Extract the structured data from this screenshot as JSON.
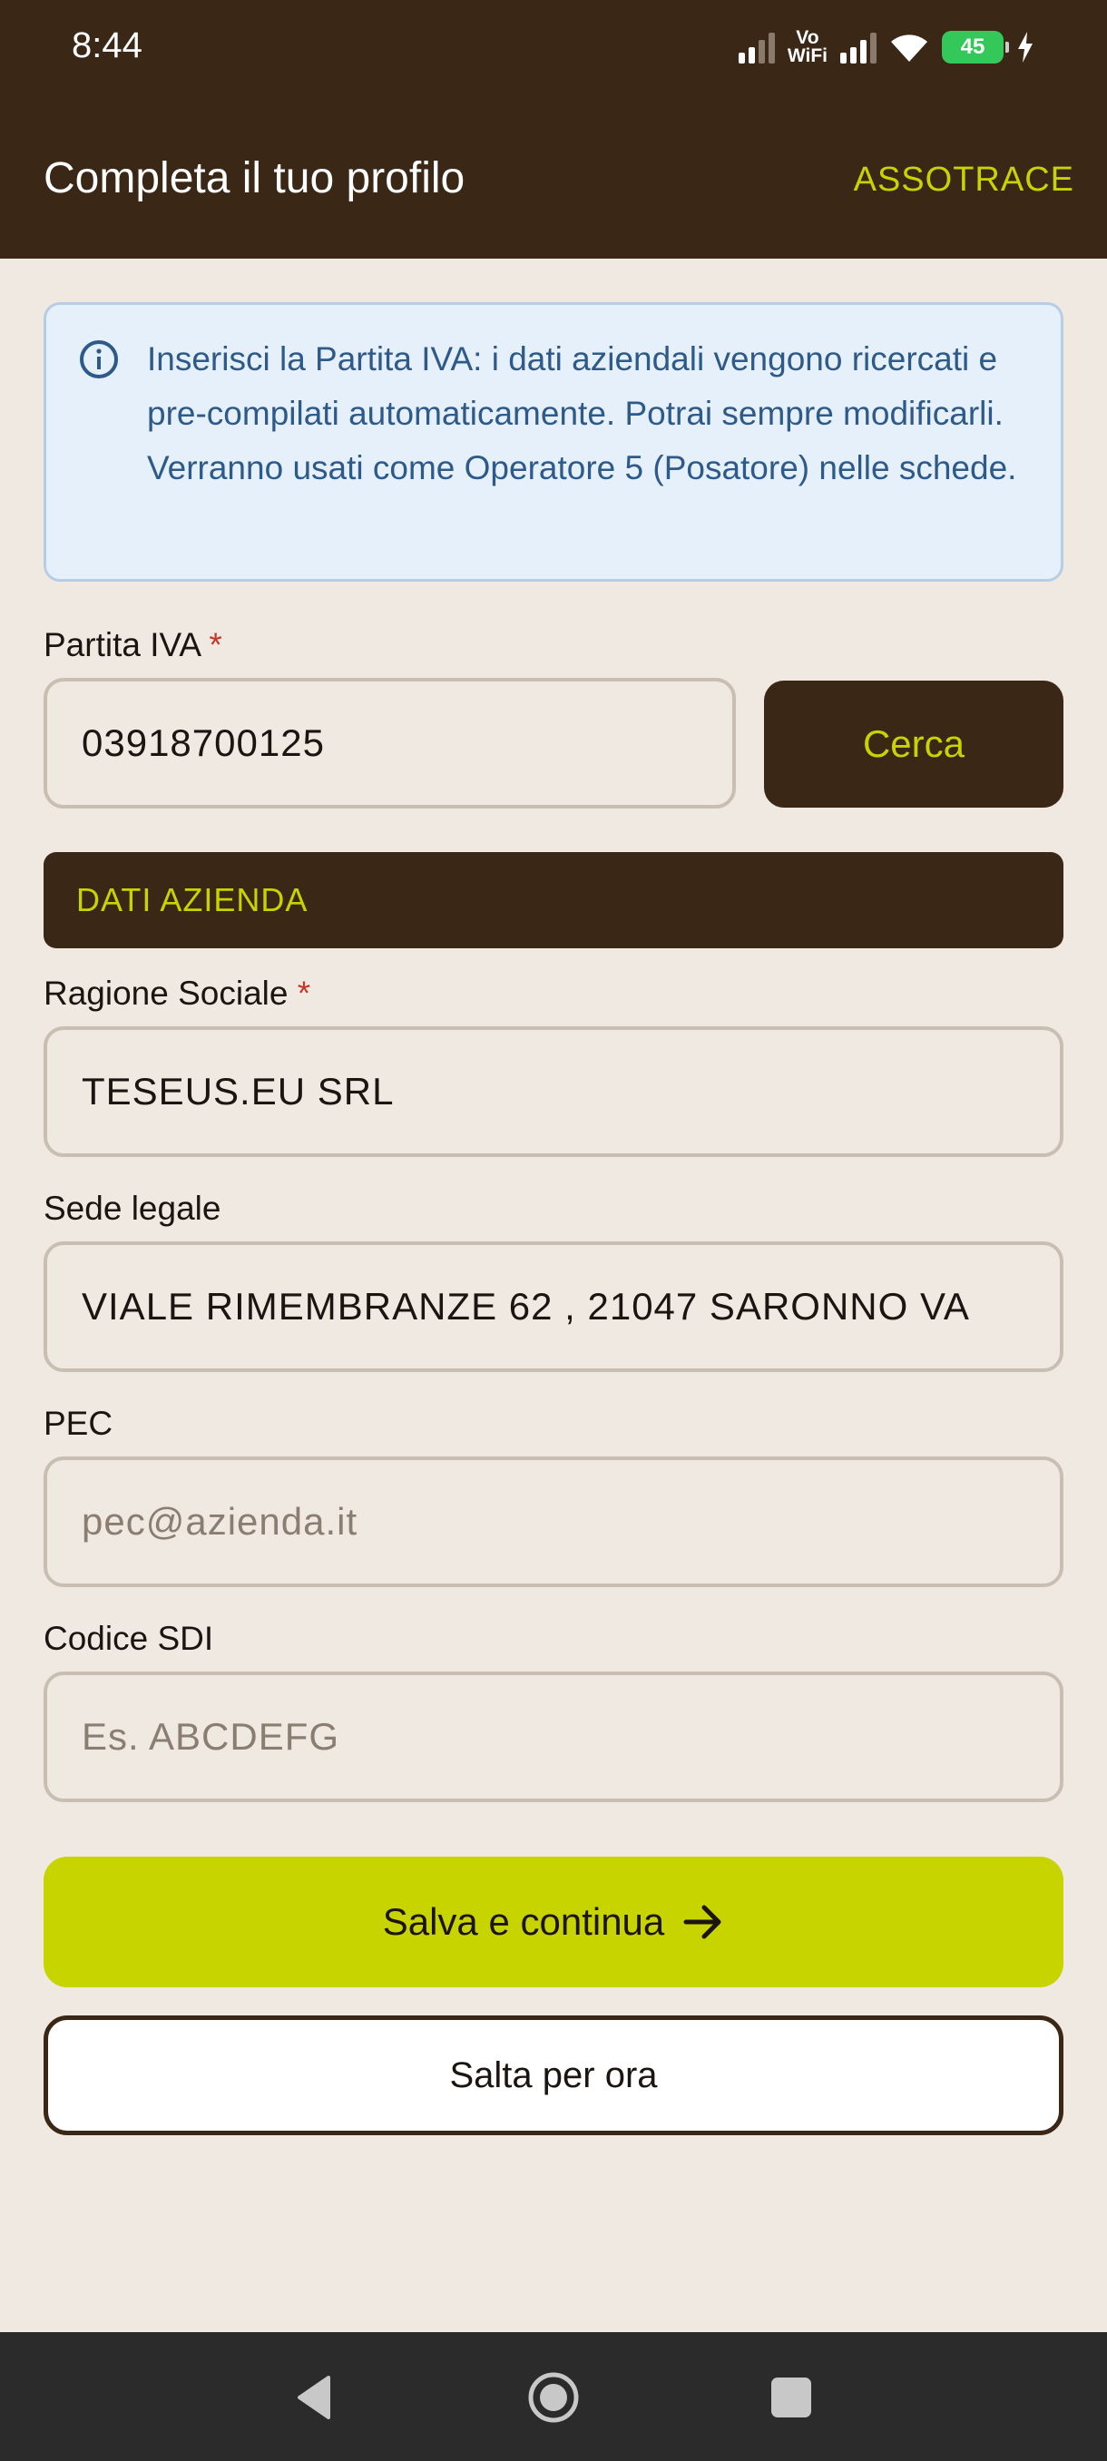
{
  "status_bar": {
    "time": "8:44",
    "vowifi_top": "Vo",
    "vowifi_bottom": "WiFi",
    "battery": "45",
    "icons": [
      "signal-icon",
      "vowifi-icon",
      "signal-icon",
      "wifi-icon",
      "battery-icon",
      "charging-icon"
    ]
  },
  "app_bar": {
    "title": "Completa il tuo profilo",
    "action": "ASSOTRACE"
  },
  "info": {
    "icon": "info-icon",
    "text": "Inserisci la Partita IVA: i dati aziendali vengono ricercati e pre-compilati automaticamente. Potrai sempre modificarli. Verranno usati come Operatore 5 (Posatore) nelle schede."
  },
  "partita_iva": {
    "label": "Partita IVA",
    "required_mark": "*",
    "value": "03918700125",
    "search_button": "Cerca"
  },
  "section": {
    "title": "DATI AZIENDA"
  },
  "ragione_sociale": {
    "label": "Ragione Sociale",
    "required_mark": "*",
    "value": "TESEUS.EU SRL"
  },
  "sede_legale": {
    "label": "Sede legale",
    "value": "VIALE RIMEMBRANZE 62 , 21047 SARONNO VA"
  },
  "pec": {
    "label": "PEC",
    "placeholder": "pec@azienda.it"
  },
  "codice_sdi": {
    "label": "Codice SDI",
    "placeholder": "Es. ABCDEFG"
  },
  "actions": {
    "primary": "Salva e continua",
    "primary_icon": "arrow-right-icon",
    "secondary": "Salta per ora"
  },
  "colors": {
    "brand_dark": "#3A2716",
    "accent": "#C8D400",
    "background": "#F0E9E1",
    "info_bg": "#E6F0FB",
    "info_text": "#2E5A8A",
    "required": "#C0392B"
  }
}
